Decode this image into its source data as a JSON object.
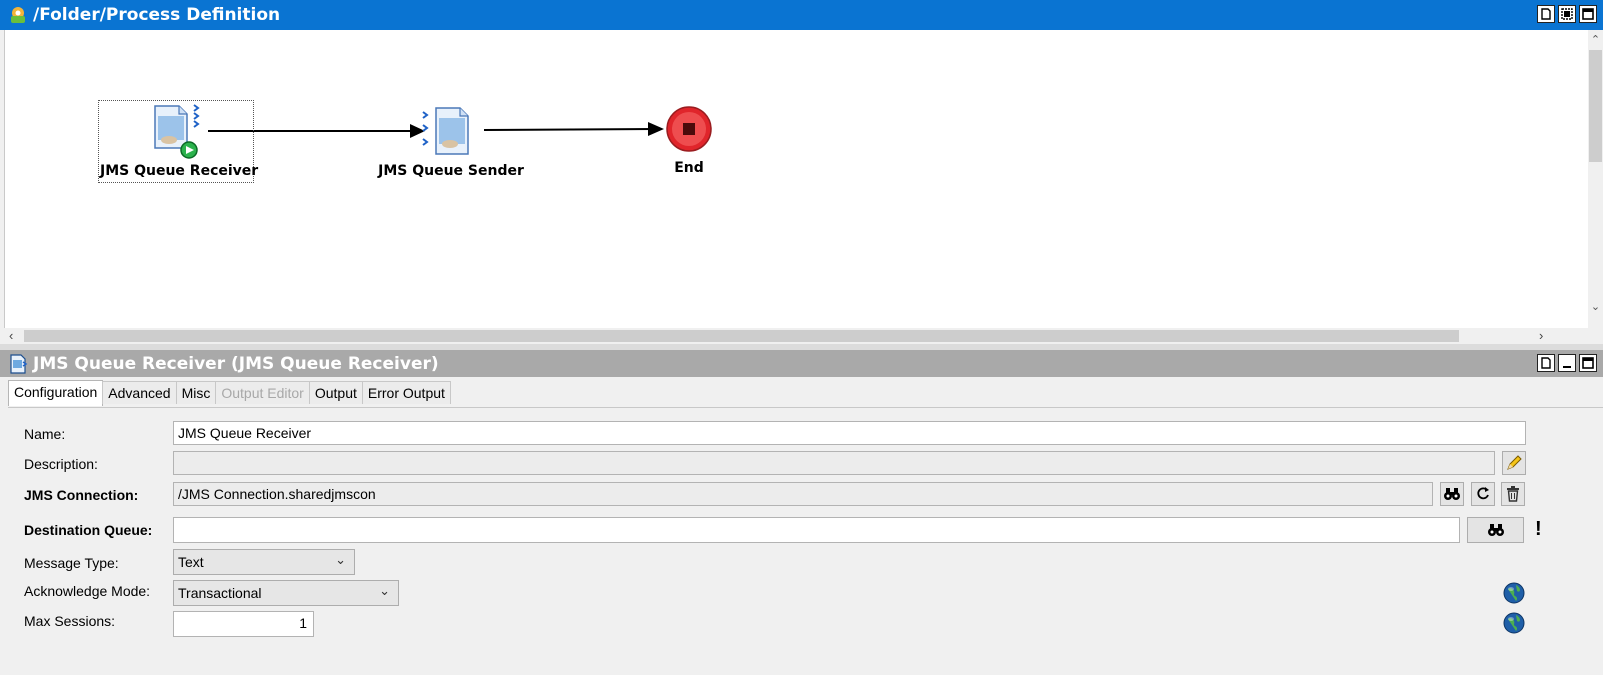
{
  "window": {
    "title": "/Folder/Process Definition",
    "buttons": [
      "restore-icon",
      "fit-icon",
      "maximize-icon"
    ]
  },
  "diagram": {
    "nodes": [
      {
        "label": "JMS Queue Receiver",
        "icon": "jms-receiver-icon",
        "selected": true
      },
      {
        "label": "JMS Queue Sender",
        "icon": "jms-sender-icon",
        "selected": false
      },
      {
        "label": "End",
        "icon": "end-stop-icon",
        "selected": false
      }
    ],
    "connections": [
      {
        "from": "JMS Queue Receiver",
        "to": "JMS Queue Sender"
      },
      {
        "from": "JMS Queue Sender",
        "to": "End"
      }
    ]
  },
  "panel": {
    "title": "JMS Queue Receiver (JMS Queue Receiver)",
    "tabs": [
      {
        "label": "Configuration",
        "active": true,
        "disabled": false
      },
      {
        "label": "Advanced",
        "active": false,
        "disabled": false
      },
      {
        "label": "Misc",
        "active": false,
        "disabled": false
      },
      {
        "label": "Output Editor",
        "active": false,
        "disabled": true
      },
      {
        "label": "Output",
        "active": false,
        "disabled": false
      },
      {
        "label": "Error Output",
        "active": false,
        "disabled": false
      }
    ],
    "fields": {
      "name": {
        "label": "Name:",
        "value": "JMS Queue Receiver"
      },
      "description": {
        "label": "Description:",
        "value": ""
      },
      "jms_connection": {
        "label": "JMS Connection:",
        "value": "/JMS Connection.sharedjmscon"
      },
      "destination_queue": {
        "label": "Destination Queue:",
        "value": "",
        "required_marker": "!"
      },
      "message_type": {
        "label": "Message Type:",
        "value": "Text"
      },
      "acknowledge_mode": {
        "label": "Acknowledge Mode:",
        "value": "Transactional"
      },
      "max_sessions": {
        "label": "Max Sessions:",
        "value": "1"
      }
    }
  },
  "colors": {
    "titlebar": "#0a74d2",
    "panel_title": "#a9a9a9",
    "end_node": "#e0252b"
  }
}
